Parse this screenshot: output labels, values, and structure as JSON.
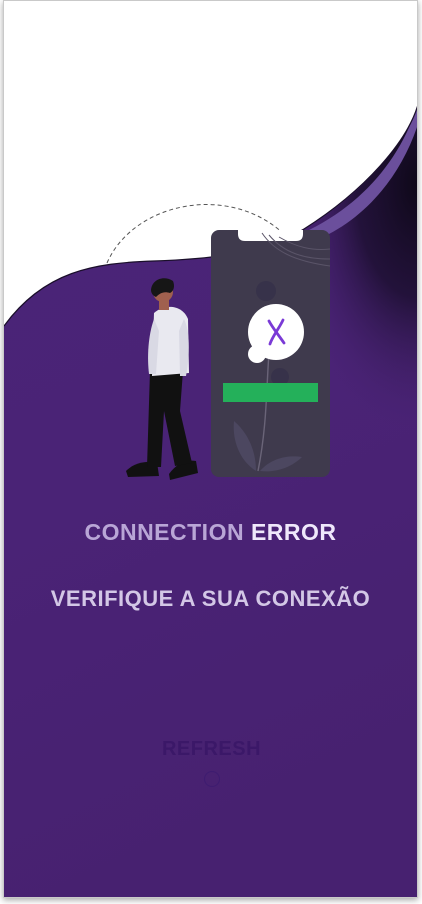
{
  "error": {
    "title_word1": "CONNECTION",
    "title_word2": "ERROR",
    "subtitle": "VERIFIQUE A SUA CONEXÃO"
  },
  "actions": {
    "refresh_label": "REFRESH"
  },
  "illustration": {
    "status_icon": "x-mark-icon",
    "bar_color": "#24b05a",
    "accent_color": "#6a3fb5"
  },
  "colors": {
    "background_purple": "#492273",
    "phone_body": "#3f3a4d",
    "wave_accent": "#6b4f9c"
  }
}
